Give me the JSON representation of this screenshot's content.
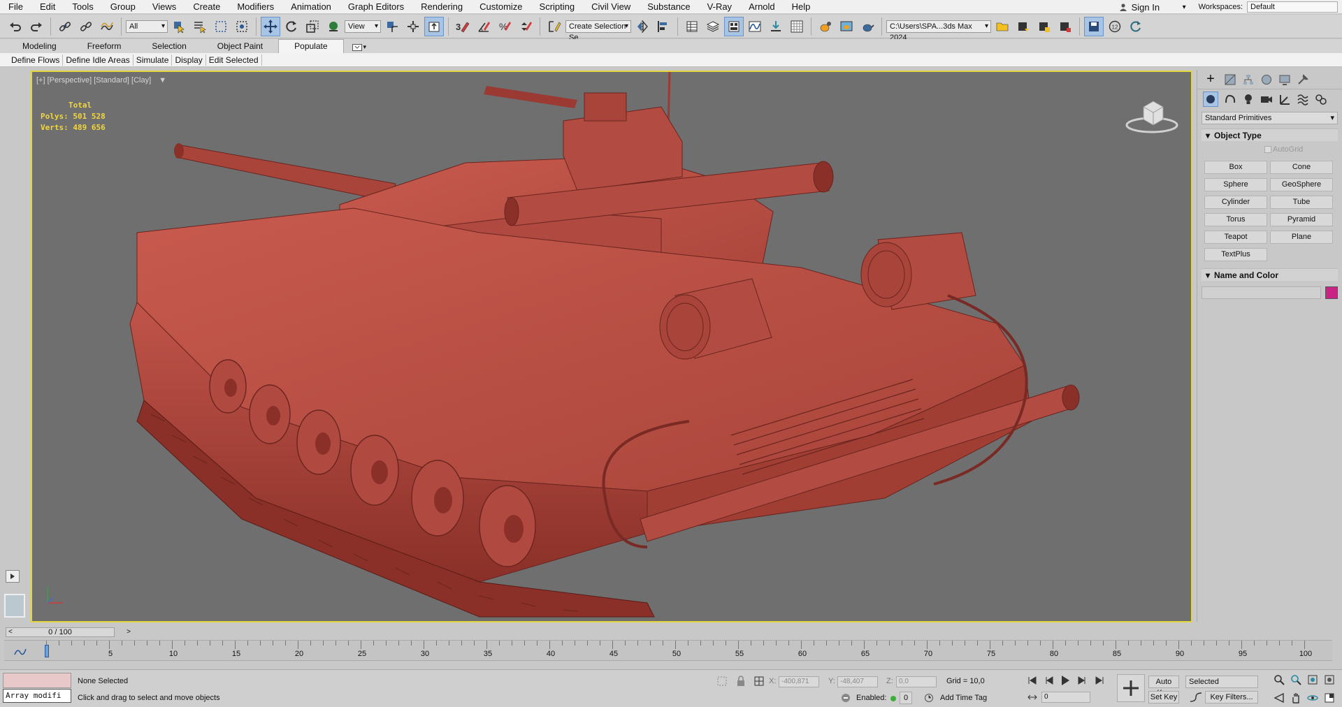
{
  "menu": {
    "items": [
      "File",
      "Edit",
      "Tools",
      "Group",
      "Views",
      "Create",
      "Modifiers",
      "Animation",
      "Graph Editors",
      "Rendering",
      "Customize",
      "Scripting",
      "Civil View",
      "Substance",
      "V-Ray",
      "Arnold",
      "Help"
    ],
    "sign_in": "Sign In",
    "workspaces_label": "Workspaces:",
    "workspace_value": "Default"
  },
  "toolbar": {
    "filter_value": "All",
    "coord_value": "View",
    "selection_set_placeholder": "Create Selection Se",
    "project_path": "C:\\Users\\SPA...3ds Max 2024"
  },
  "ribbon": {
    "tabs": [
      "Modeling",
      "Freeform",
      "Selection",
      "Object Paint",
      "Populate"
    ],
    "active_tab": "Populate",
    "sub_buttons": [
      "Define Flows",
      "Define Idle Areas",
      "Simulate",
      "Display",
      "Edit Selected"
    ]
  },
  "viewport": {
    "label": "[+] [Perspective] [Standard] [Clay]",
    "stats_total": "Total",
    "polys_label": "Polys:",
    "polys_value": "501 528",
    "verts_label": "Verts:",
    "verts_value": "489 656",
    "border_color": "#e3d63a",
    "model_color": "#b84a40"
  },
  "command_panel": {
    "category": "Standard Primitives",
    "object_type_title": "Object Type",
    "autogrid": "AutoGrid",
    "buttons": [
      "Box",
      "Cone",
      "Sphere",
      "GeoSphere",
      "Cylinder",
      "Tube",
      "Torus",
      "Pyramid",
      "Teapot",
      "Plane",
      "TextPlus"
    ],
    "name_color_title": "Name and Color",
    "swatch_color": "#c92384"
  },
  "timeline": {
    "frame_display": "0 / 100",
    "ticks": [
      "5",
      "10",
      "15",
      "20",
      "25",
      "30",
      "35",
      "40",
      "45",
      "50",
      "55",
      "60",
      "65",
      "70",
      "75",
      "80",
      "85",
      "90",
      "95",
      "100"
    ]
  },
  "status": {
    "maxscript": "Array modifi",
    "selection": "None Selected",
    "prompt": "Click and drag to select and move objects",
    "x_label": "X:",
    "x_value": "-400,871",
    "y_label": "Y:",
    "y_value": "-48,407",
    "z_label": "Z:",
    "z_value": "0,0",
    "grid": "Grid = 10,0",
    "enabled_label": "Enabled:",
    "enabled_value": "0",
    "add_time_tag": "Add Time Tag",
    "auto_key": "Auto Key",
    "set_key": "Set Key",
    "key_mode": "Selected",
    "frame_value": "0",
    "key_filters": "Key Filters..."
  }
}
